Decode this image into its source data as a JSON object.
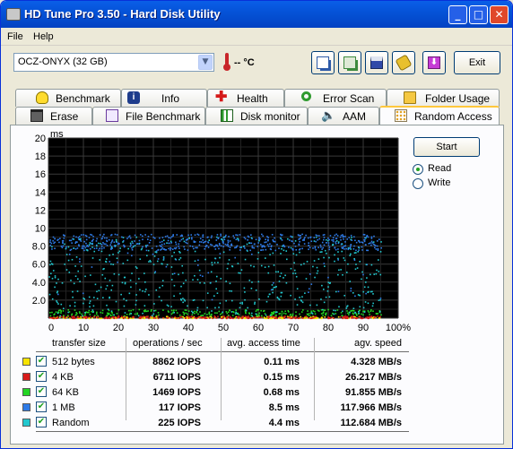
{
  "window": {
    "title": "HD Tune Pro 3.50 - Hard Disk Utility",
    "minimize": "_",
    "maximize": "□",
    "close": "✕"
  },
  "menu": {
    "file": "File",
    "help": "Help"
  },
  "toolbar": {
    "drive": "OCZ-ONYX (32 GB)",
    "temperature": "-- °C",
    "exit": "Exit",
    "icons": [
      "copy-text-icon",
      "copy-screenshot-icon",
      "save-icon",
      "options-icon",
      "download-icon"
    ]
  },
  "tabs_top": [
    "Benchmark",
    "Info",
    "Health",
    "Error Scan",
    "Folder Usage"
  ],
  "tabs_bottom": [
    "Erase",
    "File Benchmark",
    "Disk monitor",
    "AAM",
    "Random Access"
  ],
  "active_tab": "Random Access",
  "controls": {
    "start": "Start",
    "read": "Read",
    "write": "Write",
    "mode": "Read"
  },
  "chart_data": {
    "type": "scatter",
    "ylabel": "ms",
    "y_ticks": [
      "20",
      "18",
      "16",
      "14",
      "12",
      "10",
      "8.0",
      "6.0",
      "4.0",
      "2.0"
    ],
    "x_ticks": [
      "0",
      "10",
      "20",
      "30",
      "40",
      "50",
      "60",
      "70",
      "80",
      "90",
      "100%"
    ],
    "ylim": [
      0,
      20
    ],
    "xlim": [
      0,
      100
    ],
    "grid": true,
    "background": "#000000",
    "series": [
      {
        "name": "512 bytes",
        "color": "#f7e300",
        "access_ms": 0.11
      },
      {
        "name": "4 KB",
        "color": "#d81b1b",
        "access_ms": 0.15
      },
      {
        "name": "64 KB",
        "color": "#23d523",
        "access_ms": 0.68
      },
      {
        "name": "1 MB",
        "color": "#2e7ae6",
        "access_ms": 8.5
      },
      {
        "name": "Random",
        "color": "#22c8cf",
        "access_ms": 4.4
      }
    ]
  },
  "table": {
    "headers": [
      "transfer size",
      "operations / sec",
      "avg. access time",
      "agv. speed"
    ],
    "rows": [
      {
        "label": "512 bytes",
        "color": "#f7e300",
        "iops": "8862 IOPS",
        "access": "0.11 ms",
        "speed": "4.328 MB/s"
      },
      {
        "label": "4 KB",
        "color": "#d81b1b",
        "iops": "6711 IOPS",
        "access": "0.15 ms",
        "speed": "26.217 MB/s"
      },
      {
        "label": "64 KB",
        "color": "#23d523",
        "iops": "1469 IOPS",
        "access": "0.68 ms",
        "speed": "91.855 MB/s"
      },
      {
        "label": "1 MB",
        "color": "#2e7ae6",
        "iops": "117 IOPS",
        "access": "8.5 ms",
        "speed": "117.966 MB/s"
      },
      {
        "label": "Random",
        "color": "#22c8cf",
        "iops": "225 IOPS",
        "access": "4.4 ms",
        "speed": "112.684 MB/s"
      }
    ]
  }
}
